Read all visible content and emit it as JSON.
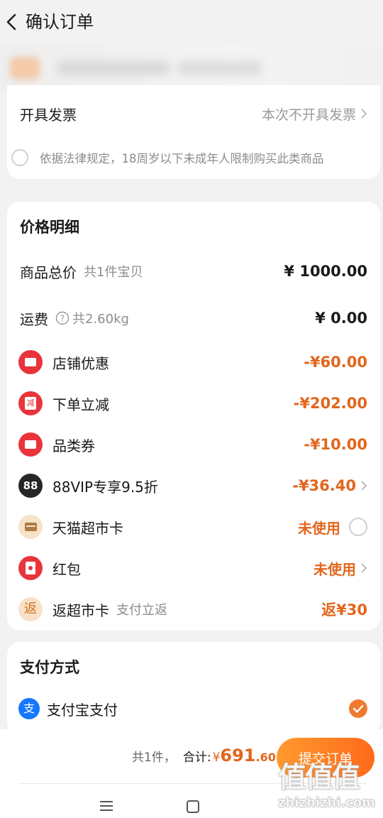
{
  "header": {
    "title": "确认订单"
  },
  "invoice": {
    "label": "开具发票",
    "value": "本次不开具发票",
    "notice": "依据法律规定，18周岁以下未成年人限制购买此类商品"
  },
  "price_detail": {
    "title": "价格明细",
    "goods_total": {
      "label": "商品总价",
      "sub": "共1件宝贝",
      "amount": "¥ 1000.00"
    },
    "shipping": {
      "label": "运费",
      "sub": "共2.60kg",
      "amount": "¥ 0.00"
    },
    "discounts": [
      {
        "label": "店铺优惠",
        "amount": "-¥60.00",
        "icon": "ticket-icon"
      },
      {
        "label": "下单立减",
        "amount": "-¥202.00",
        "icon": "reduce-icon",
        "icon_text": "减"
      },
      {
        "label": "品类券",
        "amount": "-¥10.00",
        "icon": "ticket-icon"
      },
      {
        "label": "88VIP专享9.5折",
        "amount": "-¥36.40",
        "icon": "vip-88-icon",
        "icon_text": "88"
      },
      {
        "label": "天猫超市卡",
        "amount": "未使用",
        "icon": "card-icon"
      },
      {
        "label": "红包",
        "amount": "未使用",
        "icon": "red-envelope-icon"
      },
      {
        "label": "返超市卡",
        "sub": "支付立返",
        "amount": "返¥30",
        "icon": "cashback-icon",
        "icon_text": "返"
      }
    ]
  },
  "payment": {
    "title": "支付方式",
    "method": "支付宝支付",
    "icon_text": "支"
  },
  "footer": {
    "count": "共1件，",
    "total_label": "合计:",
    "currency": "¥",
    "total_int": "691",
    "total_dec": ".60",
    "submit": "提交订单"
  },
  "watermark": {
    "text": "值值值",
    "site": "zhizhizhi.com"
  },
  "colors": {
    "accent": "#e3651c",
    "red_badge": "#e8343a",
    "button_start": "#ff9a2e",
    "button_end": "#ff6a1a"
  }
}
